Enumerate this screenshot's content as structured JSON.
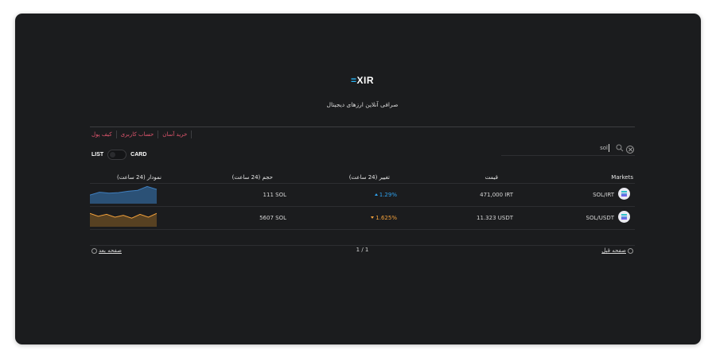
{
  "brand": {
    "logo_mark": "=",
    "logo_text": "XIR",
    "tagline": "صرافی آنلاین ارزهای دیجیتال"
  },
  "links": [
    "خرید آسان",
    "حساب کاربری",
    "کیف پول"
  ],
  "view_toggle": {
    "left_label": "LIST",
    "right_label": "CARD"
  },
  "search": {
    "value": "sol",
    "placeholder": ""
  },
  "table": {
    "headers": {
      "markets": "Markets",
      "price": "قیمت",
      "change": "تغییر (24 ساعت)",
      "volume": "حجم (24 ساعت)",
      "chart": "نمودار (24 ساعت)"
    },
    "rows": [
      {
        "market": "SOL/IRT",
        "price": "471,000 IRT",
        "change": "1.29%",
        "direction": "up",
        "volume": "111 SOL",
        "spark": [
          0.55,
          0.4,
          0.45,
          0.42,
          0.35,
          0.3,
          0.1,
          0.25
        ],
        "color": "#2e5a86"
      },
      {
        "market": "SOL/USDT",
        "price": "11.323 USDT",
        "change": "1.625%",
        "direction": "down",
        "volume": "5607 SOL",
        "spark": [
          0.3,
          0.45,
          0.35,
          0.5,
          0.4,
          0.55,
          0.35,
          0.5,
          0.3
        ],
        "color": "#c8872a"
      }
    ]
  },
  "pagination": {
    "prev_label": "صفحه قبل",
    "next_label": "صفحه بعد",
    "page_text": "1 / 1"
  },
  "colors": {
    "accent": "#29b6f6",
    "link": "#e0566e",
    "up": "#2fa3f0",
    "down": "#f3a13b"
  }
}
